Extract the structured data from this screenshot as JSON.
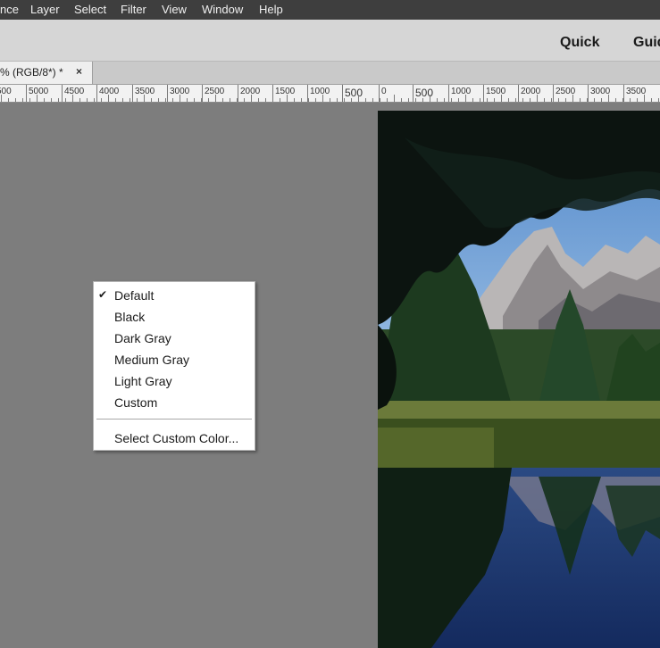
{
  "menubar": {
    "items": [
      "nce",
      "Layer",
      "Select",
      "Filter",
      "View",
      "Window",
      "Help"
    ]
  },
  "modebar": {
    "modes": [
      "Quick",
      "Guid"
    ]
  },
  "document_tab": {
    "title": "% (RGB/8*) *",
    "close": "×"
  },
  "ruler": {
    "labels": [
      "500",
      "5000",
      "4500",
      "4000",
      "3500",
      "3000",
      "2500",
      "2000",
      "1500",
      "1000",
      "500",
      "0",
      "500",
      "1000",
      "1500",
      "2000",
      "2500",
      "3000",
      "3500"
    ]
  },
  "context_menu": {
    "items": [
      {
        "label": "Default",
        "checked": true
      },
      {
        "label": "Black",
        "checked": false
      },
      {
        "label": "Dark Gray",
        "checked": false
      },
      {
        "label": "Medium Gray",
        "checked": false
      },
      {
        "label": "Light Gray",
        "checked": false
      },
      {
        "label": "Custom",
        "checked": false
      }
    ],
    "extra_item": "Select Custom Color...",
    "check_mark": "✔"
  },
  "colors": {
    "menubar_bg": "#3e3e3e",
    "canvas_bg": "#7d7d7d",
    "modebar_bg": "#d6d6d6"
  }
}
